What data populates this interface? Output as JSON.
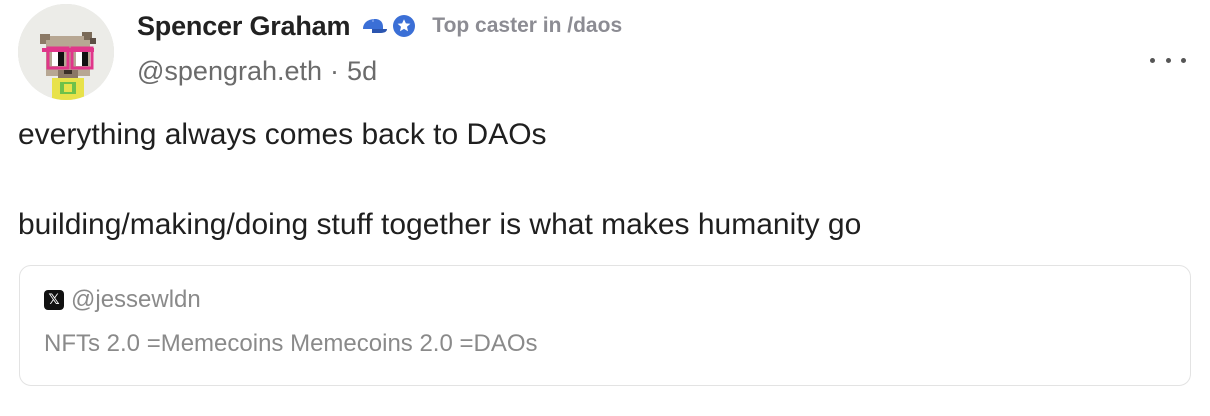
{
  "post": {
    "author": {
      "display_name": "Spencer Graham",
      "handle": "@spengrah.eth",
      "time_ago": "5d",
      "badge_text": "Top caster in /daos",
      "avatar_icon": "pixel-art-avatar-icon"
    },
    "separator": "·",
    "more_icon": "more-horizontal-icon",
    "text_lines": [
      "everything always comes back to DAOs",
      "building/making/doing stuff together is what makes humanity go"
    ],
    "embed": {
      "source_icon": "x-logo-icon",
      "source_glyph": "𝕏",
      "handle": "@jessewldn",
      "text": "NFTs 2.0 =Memecoins Memecoins 2.0 =DAOs"
    },
    "colors": {
      "accent": "#3b6fd6",
      "muted": "#8a8a8a",
      "glasses": "#e0368a"
    }
  }
}
